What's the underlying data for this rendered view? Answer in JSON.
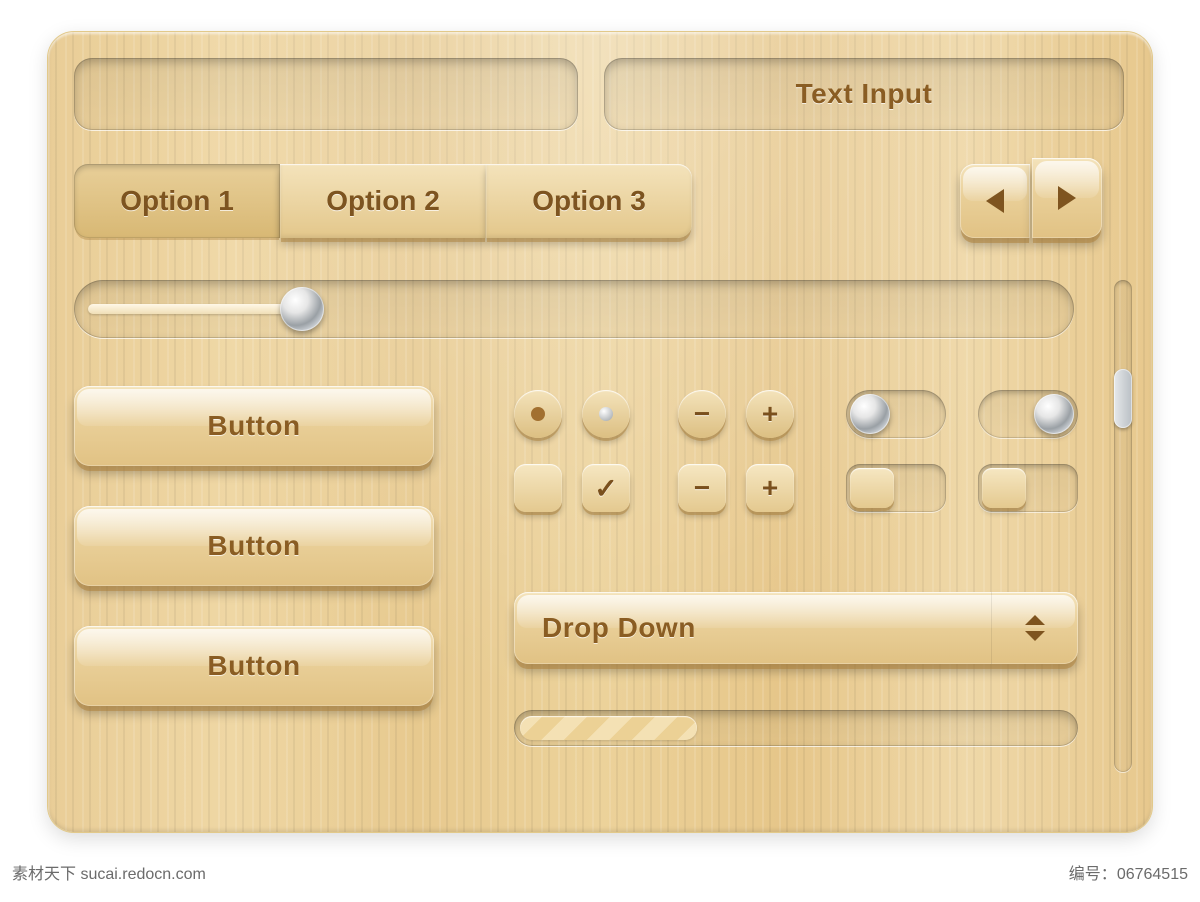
{
  "text_input_left_placeholder": "",
  "text_input_right_placeholder": "Text Input",
  "segmented_options": [
    "Option 1",
    "Option 2",
    "Option 3"
  ],
  "segmented_selected_index": 0,
  "arrow_prev": "◀",
  "arrow_next": "▶",
  "slider": {
    "min": 0,
    "max": 100,
    "value": 22
  },
  "big_buttons": [
    "Button",
    "Button",
    "Button"
  ],
  "radio": {
    "selected_index": 0
  },
  "stepper_round": {
    "minus": "−",
    "plus": "+"
  },
  "stepper_square": {
    "minus": "−",
    "plus": "+"
  },
  "checkbox": {
    "box1_checked": false,
    "box2_checked": true,
    "checkmark": "✓"
  },
  "toggle_round_1_on": false,
  "toggle_round_2_on": true,
  "toggle_square_1_on": false,
  "toggle_square_2_on": false,
  "dropdown_label": "Drop Down",
  "progress": {
    "percent": 32
  },
  "scrollbar": {
    "thumb_pos_pct": 18,
    "thumb_len_pct": 12
  },
  "footer_left_text": "素材天下 sucai.redocn.com",
  "footer_right_prefix": "编号：",
  "footer_right_id": "06764515"
}
